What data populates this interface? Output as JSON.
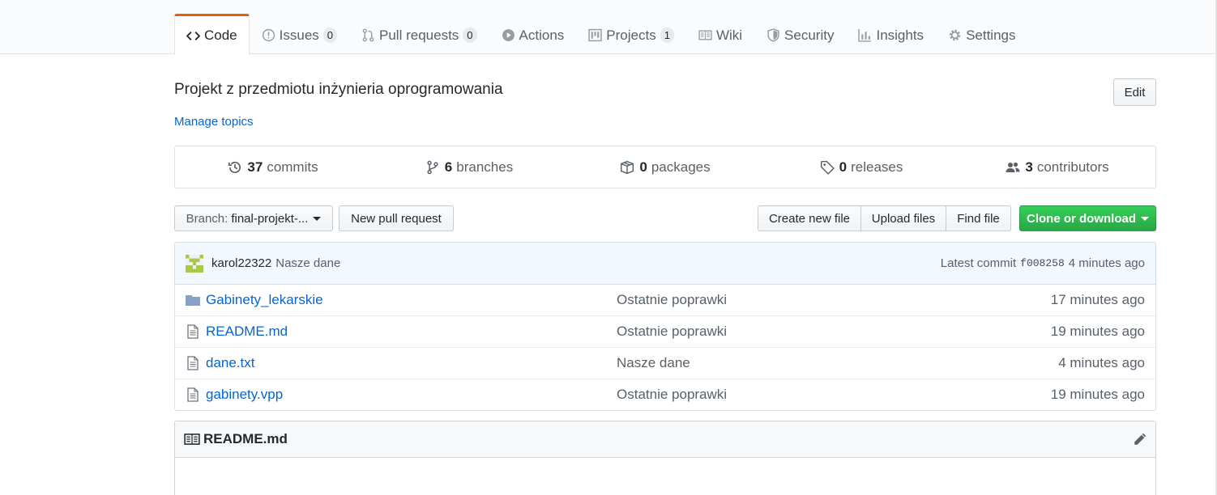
{
  "tabs": [
    {
      "label": "Code",
      "icon": "code-icon",
      "selected": true
    },
    {
      "label": "Issues",
      "icon": "issue-icon",
      "count": "0"
    },
    {
      "label": "Pull requests",
      "icon": "pull-request-icon",
      "count": "0"
    },
    {
      "label": "Actions",
      "icon": "play-icon"
    },
    {
      "label": "Projects",
      "icon": "project-icon",
      "count": "1"
    },
    {
      "label": "Wiki",
      "icon": "book-icon"
    },
    {
      "label": "Security",
      "icon": "shield-icon"
    },
    {
      "label": "Insights",
      "icon": "graph-icon"
    },
    {
      "label": "Settings",
      "icon": "gear-icon"
    }
  ],
  "repo": {
    "description": "Projekt z przedmiotu inżynieria oprogramowania",
    "edit_label": "Edit",
    "manage_topics": "Manage topics"
  },
  "numbers": {
    "commits": {
      "count": "37",
      "label": "commits"
    },
    "branches": {
      "count": "6",
      "label": "branches"
    },
    "packages": {
      "count": "0",
      "label": "packages"
    },
    "releases": {
      "count": "0",
      "label": "releases"
    },
    "contributors": {
      "count": "3",
      "label": "contributors"
    }
  },
  "toolbar": {
    "branch_prefix": "Branch:",
    "branch_name": "final-projekt-...",
    "new_pull_request": "New pull request",
    "create_new_file": "Create new file",
    "upload_files": "Upload files",
    "find_file": "Find file",
    "clone_or_download": "Clone or download"
  },
  "commit": {
    "author": "karol22322",
    "message": "Nasze dane",
    "latest_label": "Latest commit",
    "sha": "f008258",
    "age": "4 minutes ago"
  },
  "files": [
    {
      "type": "folder",
      "icon": "folder-icon",
      "name": "Gabinety_lekarskie",
      "message": "Ostatnie poprawki",
      "age": "17 minutes ago"
    },
    {
      "type": "file",
      "icon": "file-icon",
      "name": "README.md",
      "message": "Ostatnie poprawki",
      "age": "19 minutes ago"
    },
    {
      "type": "file",
      "icon": "file-icon",
      "name": "dane.txt",
      "message": "Nasze dane",
      "age": "4 minutes ago"
    },
    {
      "type": "file",
      "icon": "file-icon",
      "name": "gabinety.vpp",
      "message": "Ostatnie poprawki",
      "age": "19 minutes ago"
    }
  ],
  "readme": {
    "title": "README.md"
  },
  "colors": {
    "accent_tab": "#e36209",
    "link": "#0366d6",
    "clone_green": "#28a745",
    "commit_bg": "#f1f8ff"
  }
}
